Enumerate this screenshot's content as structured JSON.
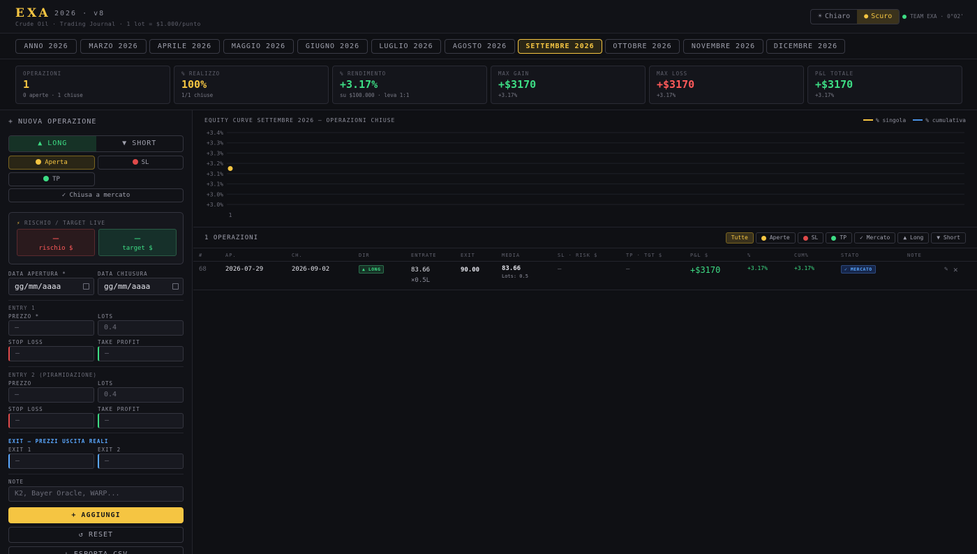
{
  "header": {
    "logo": "EXA",
    "version": "2026 · v8",
    "subtitle": "Crude Oil · Trading Journal · 1 lot = $1.000/punto",
    "theme_light": "Chiaro",
    "theme_dark": "Scuro",
    "team": "TEAM EXA · 0°02'"
  },
  "tabs": [
    "ANNO 2026",
    "MARZO 2026",
    "APRILE 2026",
    "MAGGIO 2026",
    "GIUGNO 2026",
    "LUGLIO 2026",
    "AGOSTO 2026",
    "SETTEMBRE 2026",
    "OTTOBRE 2026",
    "NOVEMBRE 2026",
    "DICEMBRE 2026"
  ],
  "stats": [
    {
      "label": "OPERAZIONI",
      "value": "1",
      "sub": "0 aperte · 1 chiuse",
      "color": "#f5c542"
    },
    {
      "label": "% REALIZZO",
      "value": "100%",
      "sub": "1/1 chiuse",
      "color": "#f5c542"
    },
    {
      "label": "% RENDIMENTO",
      "value": "+3.17%",
      "sub": "su $100.000 · leva 1:1",
      "color": "#3ddc84"
    },
    {
      "label": "MAX GAIN",
      "value": "+$3170",
      "sub": "+3.17%",
      "color": "#3ddc84"
    },
    {
      "label": "MAX LOSS",
      "value": "+$3170",
      "sub": "+3.17%",
      "color": "#ff5a5a"
    },
    {
      "label": "P&L TOTALE",
      "value": "+$3170",
      "sub": "+3.17%",
      "color": "#3ddc84"
    }
  ],
  "sidebar": {
    "title": "+ NUOVA OPERAZIONE",
    "long": "▲ LONG",
    "short": "▼ SHORT",
    "status_open": "Aperta",
    "status_sl": "SL",
    "status_tp": "TP",
    "status_market": "✓ Chiusa a mercato",
    "risk_label": "RISCHIO / TARGET LIVE",
    "risk_dash": "—",
    "risk_caption": "rischio $",
    "target_dash": "—",
    "target_caption": "target $",
    "date_open_label": "DATA APERTURA *",
    "date_close_label": "DATA CHIUSURA",
    "date_open_value": "gg/mm/aaaa",
    "date_close_value": "gg/mm/aaaa",
    "entry1_label": "ENTRY 1",
    "price_req_label": "PREZZO *",
    "lots_label": "LOTS",
    "sl_label": "STOP LOSS",
    "tp_label": "TAKE PROFIT",
    "entry2_label": "ENTRY 2 (PIRAMIDAZIONE)",
    "price_label": "PREZZO",
    "exit_section": "EXIT — PREZZI USCITA REALI",
    "exit1_label": "EXIT 1",
    "exit2_label": "EXIT 2",
    "notes_label": "NOTE",
    "notes_placeholder": "K2, Bayer Oracle, WARP...",
    "dash": "—",
    "lots_placeholder": "0.4",
    "add_button": "+ AGGIUNGI",
    "reset_button": "↺ RESET",
    "csv_button": "↓ ESPORTA CSV"
  },
  "chart_data": {
    "type": "line",
    "title": "EQUITY CURVE SETTEMBRE 2026 — OPERAZIONI CHIUSE",
    "x": [
      1
    ],
    "series": [
      {
        "name": "% singola",
        "values": [
          3.17
        ],
        "color": "#f5c542"
      },
      {
        "name": "% cumulativa",
        "values": [
          3.17
        ],
        "color": "#4a90e2"
      }
    ],
    "x_tick_labels": [
      "1"
    ],
    "y_tick_labels": [
      "+3.4%",
      "+3.3%",
      "+3.3%",
      "+3.2%",
      "+3.1%",
      "+3.1%",
      "+3.0%",
      "+3.0%"
    ],
    "ylim": [
      2.97,
      3.37
    ],
    "grid": true,
    "legend": "top-right"
  },
  "operations": {
    "count_label": "1 OPERAZIONI",
    "filters": [
      {
        "label": "Tutte",
        "dot": null,
        "active": true
      },
      {
        "label": "Aperte",
        "dot": "#f5c542",
        "active": false
      },
      {
        "label": "SL",
        "dot": "#e04a4a",
        "active": false
      },
      {
        "label": "TP",
        "dot": "#3ddc84",
        "active": false
      },
      {
        "label": "✓ Mercato",
        "dot": null,
        "active": false
      },
      {
        "label": "▲ Long",
        "dot": null,
        "active": false
      },
      {
        "label": "▼ Short",
        "dot": null,
        "active": false
      }
    ],
    "columns": [
      "#",
      "AP.",
      "CH.",
      "DIR",
      "ENTRATE",
      "EXIT",
      "MEDIA",
      "SL · RISK $",
      "TP · TGT $",
      "P&L $",
      "%",
      "CUM%",
      "STATO",
      "NOTE"
    ],
    "rows": [
      {
        "id": "68",
        "open": "2026-07-29",
        "close": "2026-09-02",
        "dir": "▲ LONG",
        "entry": "83.66",
        "entry_lots": "×0.5L",
        "exit": "90.00",
        "avg": "83.66",
        "avg_lots": "Lots: 0.5",
        "sl": "—",
        "tp": "—",
        "pnl": "+$3170",
        "pct": "+3.17%",
        "cum": "+3.17%",
        "status": "✓ MERCATO",
        "notes": ""
      }
    ]
  }
}
